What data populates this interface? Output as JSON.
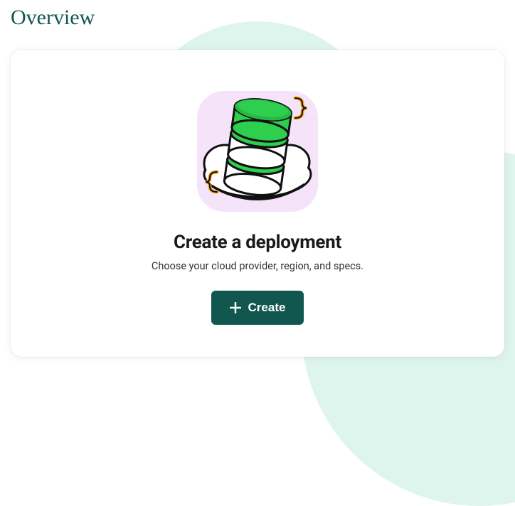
{
  "page": {
    "title": "Overview"
  },
  "card": {
    "title": "Create a deployment",
    "subtitle": "Choose your cloud provider, region, and specs.",
    "button_label": "Create"
  },
  "icons": {
    "plus": "plus-icon",
    "illustration": "database-stack-illustration"
  },
  "colors": {
    "accent": "#11574f",
    "bg_tint": "#def5ee",
    "illus_bg": "#f4e3f9",
    "illus_green": "#2ece4e",
    "illus_yellow": "#f5a623"
  }
}
